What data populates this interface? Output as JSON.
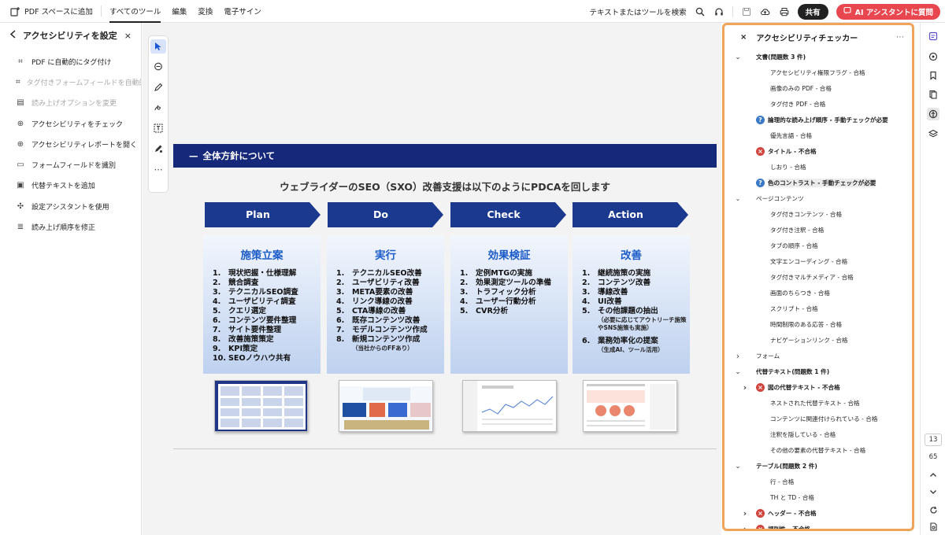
{
  "topbar": {
    "app_label": "PDF スペースに追加",
    "menu": [
      "すべてのツール",
      "編集",
      "変換",
      "電子サイン"
    ],
    "search_label": "テキストまたはツールを検索",
    "share_label": "共有",
    "ai_label": "AI アシスタントに質問"
  },
  "left_panel": {
    "title": "アクセシビリティを設定",
    "items": [
      {
        "label": "PDF に自動的にタグ付け",
        "icon": "auto-tag-icon",
        "disabled": false
      },
      {
        "label": "タグ付きフォームフィールドを自動的",
        "icon": "form-tag-icon",
        "disabled": true
      },
      {
        "label": "読み上げオプションを変更",
        "icon": "read-options-icon",
        "disabled": true
      },
      {
        "label": "アクセシビリティをチェック",
        "icon": "check-accessibility-icon",
        "disabled": false
      },
      {
        "label": "アクセシビリティレポートを開く",
        "icon": "report-icon",
        "disabled": false
      },
      {
        "label": "フォームフィールドを識別",
        "icon": "form-identify-icon",
        "disabled": false
      },
      {
        "label": "代替テキストを追加",
        "icon": "alt-text-icon",
        "disabled": false
      },
      {
        "label": "設定アシスタントを使用",
        "icon": "wizard-icon",
        "disabled": false
      },
      {
        "label": "読み上げ順序を修正",
        "icon": "reading-order-icon",
        "disabled": false
      }
    ]
  },
  "document": {
    "banner": "全体方針について",
    "subtitle": "ウェブライダーのSEO（SXO）改善支援は以下のようにPDCAを回します",
    "phases": [
      "Plan",
      "Do",
      "Check",
      "Action"
    ],
    "boxes": [
      {
        "title": "施策立案",
        "items": [
          [
            "1.",
            "現状把握・仕様理解"
          ],
          [
            "2.",
            "競合調査"
          ],
          [
            "3.",
            "テクニカルSEO調査"
          ],
          [
            "4.",
            "ユーザビリティ調査"
          ],
          [
            "5.",
            "クエリ選定"
          ],
          [
            "6.",
            "コンテンツ要件整理"
          ],
          [
            "7.",
            "サイト要件整理"
          ],
          [
            "8.",
            "改善施策策定"
          ],
          [
            "9.",
            "KPI策定"
          ],
          [
            "10.",
            "SEOノウハウ共有"
          ]
        ]
      },
      {
        "title": "実行",
        "items": [
          [
            "1.",
            "テクニカルSEO改善"
          ],
          [
            "2.",
            "ユーザビリティ改善"
          ],
          [
            "3.",
            "META要素の改善"
          ],
          [
            "4.",
            "リンク導線の改善"
          ],
          [
            "5.",
            "CTA導線の改善"
          ],
          [
            "6.",
            "既存コンテンツ改善"
          ],
          [
            "7.",
            "モデルコンテンツ作成"
          ],
          [
            "8.",
            "新規コンテンツ作成"
          ]
        ],
        "note": "（当社からのFFあり）"
      },
      {
        "title": "効果検証",
        "items": [
          [
            "1.",
            "定例MTGの実施"
          ],
          [
            "2.",
            "効果測定ツールの準備"
          ],
          [
            "3.",
            "トラフィック分析"
          ],
          [
            "4.",
            "ユーザー行動分析"
          ],
          [
            "5.",
            "CVR分析"
          ]
        ]
      },
      {
        "title": "改善",
        "items": [
          [
            "1.",
            "継続施策の実施"
          ],
          [
            "2.",
            "コンテンツ改善"
          ],
          [
            "3.",
            "導線改善"
          ],
          [
            "4.",
            "UI改善"
          ],
          [
            "5.",
            "その他課題の抽出"
          ]
        ],
        "note": "（必要に応じてアウトリーチ施策やSNS施策も実施）",
        "extra": [
          "6.",
          "業務効率化の提案"
        ],
        "extra_note": "（生成AI、ツール活用）"
      }
    ]
  },
  "checker": {
    "title": "アクセシビリティチェッカー",
    "rows": [
      {
        "level": 0,
        "chev": "down",
        "label": "文書(問題数 3 件)",
        "bold": true
      },
      {
        "level": 2,
        "label": "アクセシビリティ権限フラグ - 合格"
      },
      {
        "level": 2,
        "label": "画像のみの PDF - 合格"
      },
      {
        "level": 2,
        "label": "タグ付き PDF - 合格"
      },
      {
        "level": 1,
        "badge": "q",
        "label": "論理的な読み上げ順序 - 手動チェックが必要",
        "bold": true
      },
      {
        "level": 2,
        "label": "優先言語 - 合格"
      },
      {
        "level": 1,
        "badge": "x",
        "label": "タイトル - 不合格",
        "bold": true
      },
      {
        "level": 2,
        "label": "しおり - 合格"
      },
      {
        "level": 1,
        "badge": "q",
        "label": "色のコントラスト - 手動チェックが必要",
        "bold": true,
        "highlight": true
      },
      {
        "level": 0,
        "chev": "down",
        "label": "ページコンテンツ"
      },
      {
        "level": 2,
        "label": "タグ付きコンテンツ - 合格"
      },
      {
        "level": 2,
        "label": "タグ付き注釈 - 合格"
      },
      {
        "level": 2,
        "label": "タブの順序 - 合格"
      },
      {
        "level": 2,
        "label": "文字エンコーディング - 合格"
      },
      {
        "level": 2,
        "label": "タグ付きマルチメディア - 合格"
      },
      {
        "level": 2,
        "label": "画面のちらつき - 合格"
      },
      {
        "level": 2,
        "label": "スクリプト - 合格"
      },
      {
        "level": 2,
        "label": "時間制限のある応答 - 合格"
      },
      {
        "level": 2,
        "label": "ナビゲーションリンク - 合格"
      },
      {
        "level": 0,
        "chev": "right",
        "label": "フォーム"
      },
      {
        "level": 0,
        "chev": "down",
        "label": "代替テキスト(問題数 1 件)",
        "bold": true
      },
      {
        "level": 1,
        "chev": "right",
        "badge": "x",
        "label": "図の代替テキスト - 不合格",
        "bold": true
      },
      {
        "level": 2,
        "label": "ネストされた代替テキスト - 合格"
      },
      {
        "level": 2,
        "label": "コンテンツに関連付けられている - 合格"
      },
      {
        "level": 2,
        "label": "注釈を隠している - 合格"
      },
      {
        "level": 2,
        "label": "その他の要素の代替テキスト - 合格"
      },
      {
        "level": 0,
        "chev": "down",
        "label": "テーブル(問題数 2 件)",
        "bold": true
      },
      {
        "level": 2,
        "label": "行 - 合格"
      },
      {
        "level": 2,
        "label": "TH と TD - 合格"
      },
      {
        "level": 1,
        "chev": "right",
        "badge": "x",
        "label": "ヘッダー - 不合格",
        "bold": true
      },
      {
        "level": 1,
        "chev": "right",
        "badge": "x",
        "label": "規則性 - 不合格",
        "bold": true
      }
    ]
  },
  "rail": {
    "page_current": "13",
    "page_total": "65"
  },
  "colors": {
    "banner": "#16287a",
    "phase": "#1b3a8f",
    "accent_orange": "#f0a45a",
    "ai_red": "#e8474f",
    "box_title": "#1d5cc8"
  }
}
